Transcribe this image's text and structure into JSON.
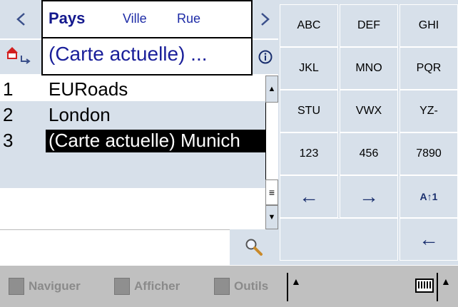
{
  "search_panel": {
    "tabs": [
      {
        "label": "Pays"
      },
      {
        "label": "Ville"
      },
      {
        "label": "Rue"
      }
    ],
    "map_value": "(Carte actuelle) ...",
    "results": [
      {
        "num": "1",
        "name": "EURoads"
      },
      {
        "num": "2",
        "name": "London"
      },
      {
        "num": "3",
        "name": "(Carte actuelle) Munich"
      }
    ]
  },
  "keyboard": {
    "keys": [
      "ABC",
      "DEF",
      "GHI",
      "JKL",
      "MNO",
      "PQR",
      "STU",
      "VWX",
      "YZ-",
      "123",
      "456",
      "7890"
    ],
    "arrow_left": "←",
    "arrow_right": "→",
    "backspace": "←",
    "shift_label": "A↑1"
  },
  "taskbar": {
    "items": [
      {
        "label": "Naviguer"
      },
      {
        "label": "Afficher"
      },
      {
        "label": "Outils"
      }
    ],
    "caret": "▲"
  },
  "colors": {
    "panel_bg": "#d7e0ea",
    "text_blue": "#1a1f9a",
    "taskbar_bg": "#c0c0c0"
  }
}
